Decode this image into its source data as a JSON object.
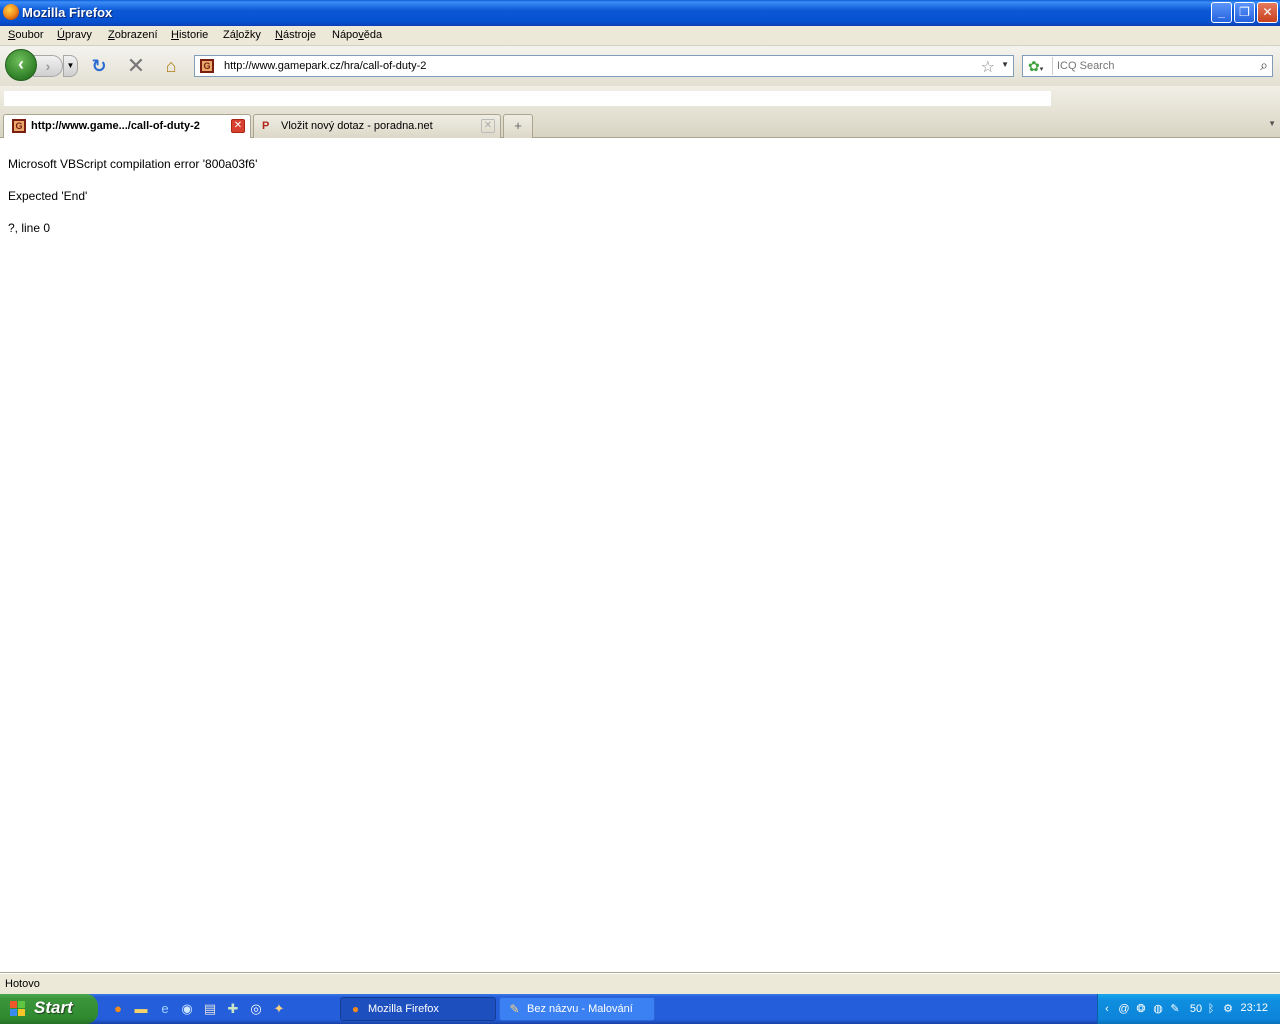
{
  "window": {
    "title": "Mozilla Firefox",
    "controls": {
      "minimize": "_",
      "restore": "❐",
      "close": "✕"
    }
  },
  "menu": [
    {
      "pre": "",
      "key": "S",
      "post": "oubor"
    },
    {
      "pre": "",
      "key": "Ú",
      "post": "pravy"
    },
    {
      "pre": "",
      "key": "Z",
      "post": "obrazení"
    },
    {
      "pre": "",
      "key": "H",
      "post": "istorie"
    },
    {
      "pre": "Zá",
      "key": "l",
      "post": "ožky"
    },
    {
      "pre": "",
      "key": "N",
      "post": "ástroje"
    },
    {
      "pre": "Nápo",
      "key": "v",
      "post": "ěda"
    }
  ],
  "nav": {
    "back_glyph": "‹",
    "forward_glyph": "›",
    "history_dropdown_glyph": "▼",
    "reload_glyph": "↻",
    "stop_glyph": "✕",
    "home_glyph": "⌂",
    "url": "http://www.gamepark.cz/hra/call-of-duty-2",
    "site_icon_letter": "G",
    "star_glyph": "☆",
    "url_dropdown_glyph": "▼"
  },
  "search": {
    "placeholder": "ICQ Search",
    "engine_glyph": "✿",
    "go_glyph": "⌕"
  },
  "tabs": [
    {
      "label": "http://www.game.../call-of-duty-2",
      "favicon": "G",
      "active": true,
      "close_glyph": "✕"
    },
    {
      "label": "Vložit nový dotaz - poradna.net",
      "favicon": "P",
      "active": false,
      "close_glyph": "✕"
    }
  ],
  "new_tab_glyph": "+",
  "tab_list_glyph": "▼",
  "content": {
    "lines": [
      "Microsoft VBScript compilation error '800a03f6'",
      "Expected 'End'",
      "?, line 0"
    ]
  },
  "status": {
    "text": "Hotovo"
  },
  "taskbar": {
    "start_label": "Start",
    "quick_launch": [
      "firefox-icon",
      "folder-icon",
      "ie-icon",
      "app-icon",
      "notepad-icon",
      "tool-icon",
      "media-icon",
      "icq-icon"
    ],
    "tasks": [
      {
        "label": "Mozilla Firefox",
        "active": true
      },
      {
        "label": "Bez názvu - Malování",
        "active": false
      }
    ],
    "tray": {
      "volume_label": "50",
      "clock": "23:12"
    }
  },
  "colors": {
    "titlebar": "#0b58d6",
    "taskbar": "#245edb",
    "start_button": "#3c963c",
    "tray": "#0f8fe0",
    "chrome": "#ece9d8"
  }
}
